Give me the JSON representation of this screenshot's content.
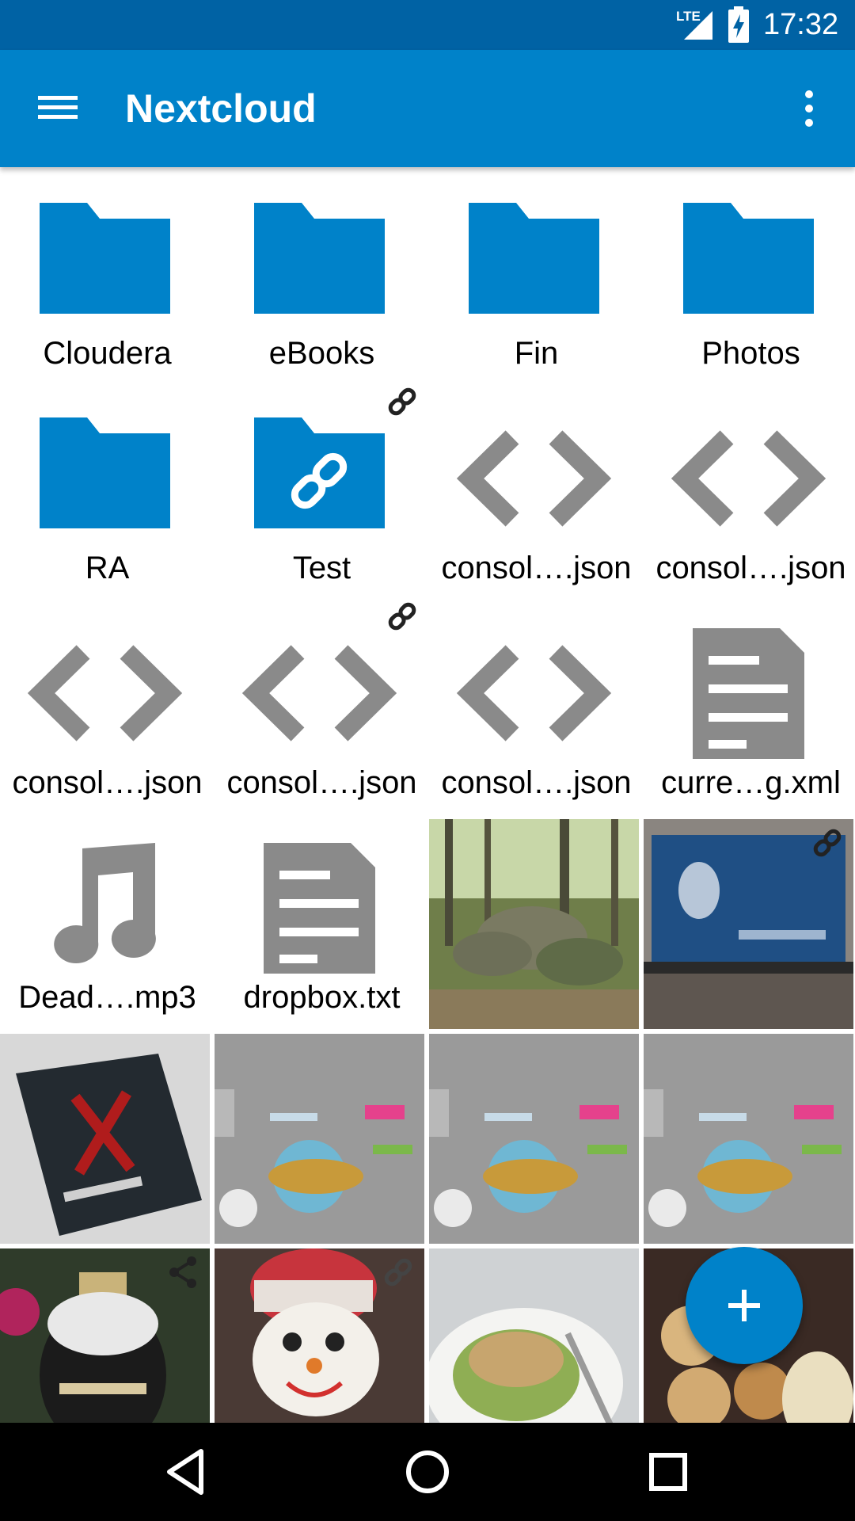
{
  "status_bar": {
    "network_label": "LTE",
    "time": "17:32",
    "icons": [
      "lte-signal-icon",
      "battery-charging-icon"
    ]
  },
  "app_bar": {
    "title": "Nextcloud",
    "menu_icon": "hamburger-menu-icon",
    "overflow_icon": "more-vert-icon"
  },
  "colors": {
    "status_bar": "#0062a4",
    "app_bar": "#0082c9",
    "folder": "#0082c9",
    "file_icon": "#8a8a8a",
    "fab": "#0082c9",
    "nav_bar": "#000000"
  },
  "files": [
    {
      "name": "Cloudera",
      "type": "folder",
      "shared_link": false
    },
    {
      "name": "eBooks",
      "type": "folder",
      "shared_link": false
    },
    {
      "name": "Fin",
      "type": "folder",
      "shared_link": false
    },
    {
      "name": "Photos",
      "type": "folder",
      "shared_link": false
    },
    {
      "name": "RA",
      "type": "folder",
      "shared_link": false
    },
    {
      "name": "Test",
      "type": "folder-shared",
      "shared_link": true
    },
    {
      "name": "consol….json",
      "type": "code",
      "shared_link": false
    },
    {
      "name": "consol….json",
      "type": "code",
      "shared_link": false
    },
    {
      "name": "consol….json",
      "type": "code",
      "shared_link": false
    },
    {
      "name": "consol….json",
      "type": "code",
      "shared_link": true
    },
    {
      "name": "consol….json",
      "type": "code",
      "shared_link": false
    },
    {
      "name": "curre…g.xml",
      "type": "document",
      "shared_link": false
    },
    {
      "name": "Dead….mp3",
      "type": "audio",
      "shared_link": false
    },
    {
      "name": "dropbox.txt",
      "type": "document",
      "shared_link": false
    }
  ],
  "image_thumbnails": [
    {
      "subject": "forest-rocks-photo",
      "badge": ""
    },
    {
      "subject": "tv-screen-photo",
      "badge": "link-icon"
    },
    {
      "subject": "assassins-creed-box-photo",
      "badge": ""
    },
    {
      "subject": "phaser-logo-screenshot",
      "badge": ""
    },
    {
      "subject": "phaser-logo-screenshot",
      "badge": ""
    },
    {
      "subject": "phaser-logo-screenshot",
      "badge": ""
    },
    {
      "subject": "guinness-ornament-photo",
      "badge": "share-icon"
    },
    {
      "subject": "snowman-toy-photo",
      "badge": "link-icon"
    },
    {
      "subject": "salad-plate-photo",
      "badge": ""
    },
    {
      "subject": "dumplings-photo",
      "badge": ""
    }
  ],
  "fab": {
    "icon": "plus-icon"
  },
  "nav_bar": {
    "icons": [
      "back-icon",
      "home-icon",
      "recents-icon"
    ]
  }
}
